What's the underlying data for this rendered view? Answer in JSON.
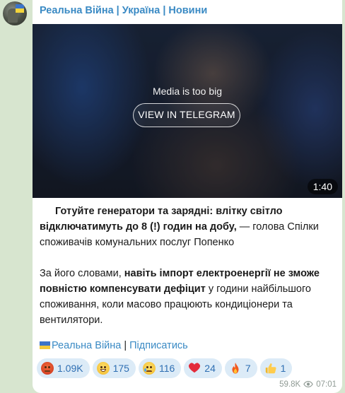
{
  "channel": {
    "title": "Реальна Війна | Україна | Новини"
  },
  "media": {
    "message": "Media is too big",
    "button_label": "VIEW IN TELEGRAM",
    "duration": "1:40"
  },
  "post": {
    "p1_bold": "Готуйте генератори та зарядні: влітку світло відключатимуть до 8 (!) годин на добу,",
    "p1_rest": " — голова Спілки споживачів комунальних послуг Попенко",
    "p2_start": "За його словами, ",
    "p2_bold": "навіть імпорт електроенергії не зможе повністю компенсувати дефіцит",
    "p2_rest": " у години найбільшого споживання, коли масово працюють кондиціонери та вентилятори."
  },
  "signature": {
    "channel_link": "Реальна Війна",
    "separator": "|",
    "subscribe_link": "Підписатись"
  },
  "reactions": [
    {
      "icon": "angry-face-icon",
      "count": "1.09K"
    },
    {
      "icon": "grinning-face-icon",
      "count": "175"
    },
    {
      "icon": "crying-face-icon",
      "count": "116"
    },
    {
      "icon": "red-heart-icon",
      "count": "24"
    },
    {
      "icon": "fire-icon",
      "count": "7"
    },
    {
      "icon": "thumbs-up-icon",
      "count": "1"
    }
  ],
  "meta": {
    "views": "59.8K",
    "time": "07:01"
  },
  "colors": {
    "accent": "#3a8ac4",
    "reaction_bg": "#dcebf7",
    "chat_bg": "#d7e5cf"
  }
}
